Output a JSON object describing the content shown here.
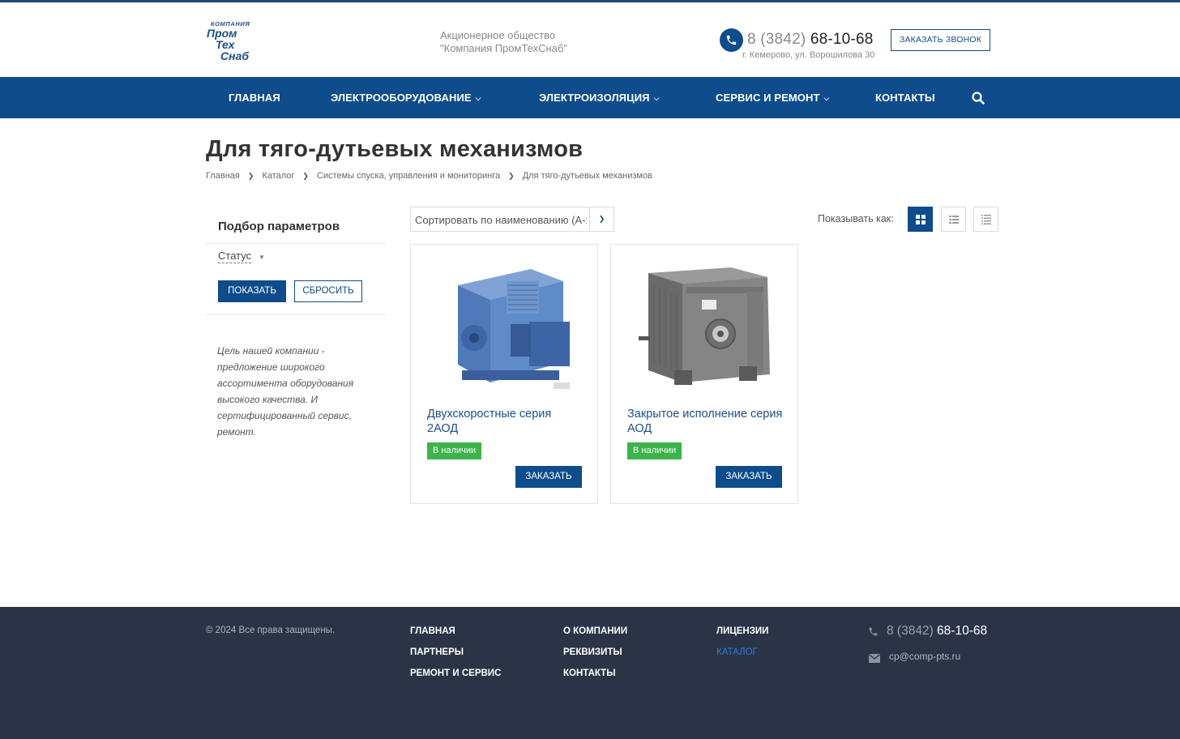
{
  "header": {
    "logo_lines": [
      "КОМПАНИЯ",
      "ПРОМ",
      "ТЕХ",
      "СНАБ"
    ],
    "company_line1": "Акционерное общество",
    "company_line2": "\"Компания ПромТехСнаб\"",
    "phone_code": "8 (3842)",
    "phone_number": "68-10-68",
    "address": "г. Кемерово, ул. Ворошилова 30",
    "callback_label": "ЗАКАЗАТЬ ЗВОНОК"
  },
  "nav": {
    "items": [
      {
        "label": "ГЛАВНАЯ"
      },
      {
        "label": "ЭЛЕКТРООБОРУДОВАНИЕ"
      },
      {
        "label": "ЭЛЕКТРОИЗОЛЯЦИЯ"
      },
      {
        "label": "СЕРВИС И РЕМОНТ"
      },
      {
        "label": "КОНТАКТЫ"
      }
    ],
    "search_icon": "search-icon"
  },
  "page": {
    "title": "Для тяго-дутьевых механизмов",
    "breadcrumb": [
      "Главная",
      "Каталог",
      "Системы спуска, управления и мониторинга",
      "Для тяго-дутьевых механизмов"
    ]
  },
  "sidebar": {
    "filter_title": "Подбор параметров",
    "status_label": "Статус",
    "show_label": "ПОКАЗАТЬ",
    "reset_label": "СБРОСИТЬ",
    "about": "Цель нашей компании - предложение широкого ассортимента оборудования высокого качества. И сертифицированный сервис, ремонт."
  },
  "toolbar": {
    "sort_value": "Сортировать по наименованию (А-Я)",
    "show_as_label": "Показывать как:"
  },
  "products": [
    {
      "name": "Двухскоростные серия 2АОД",
      "status": "В наличии",
      "order_label": "ЗАКАЗАТЬ"
    },
    {
      "name": "Закрытое исполнение серия АОД",
      "status": "В наличии",
      "order_label": "ЗАКАЗАТЬ"
    }
  ],
  "footer": {
    "copyright": "© 2024 Все права защищены.",
    "links": [
      "ГЛАВНАЯ",
      "О КОМПАНИИ",
      "ЛИЦЕНЗИИ",
      "ПАРТНЕРЫ",
      "РЕКВИЗИТЫ",
      "КАТАЛОГ",
      "РЕМОНТ И СЕРВИС",
      "КОНТАКТЫ"
    ],
    "phone_code": "8 (3842)",
    "phone_number": "68-10-68",
    "email": "cp@comp-pts.ru"
  },
  "colors": {
    "brand": "#0e4c8c",
    "in_stock": "#3cb44b",
    "footer_bg": "#2b3447",
    "footer_active": "#2f7ad6"
  }
}
